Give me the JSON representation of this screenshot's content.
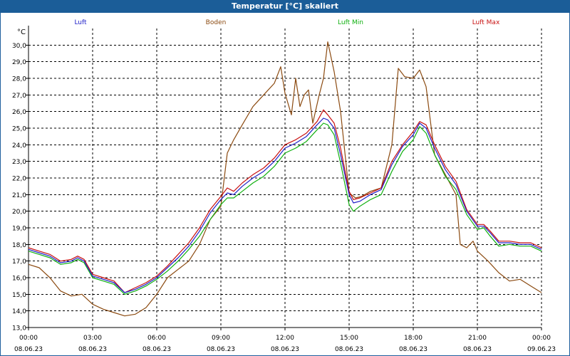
{
  "window": {
    "title": "Temperatur [°C] skaliert"
  },
  "chart_data": {
    "type": "line",
    "title": "Temperatur [°C] skaliert",
    "ylabel": "°C",
    "ylim": [
      13.0,
      31.0
    ],
    "yticks": [
      13.0,
      14.0,
      15.0,
      16.0,
      17.0,
      18.0,
      19.0,
      20.0,
      21.0,
      22.0,
      23.0,
      24.0,
      25.0,
      26.0,
      27.0,
      28.0,
      29.0,
      30.0
    ],
    "ytick_labels": [
      "13,0",
      "14,0",
      "15,0",
      "16,0",
      "17,0",
      "18,0",
      "19,0",
      "20,0",
      "21,0",
      "22,0",
      "23,0",
      "24,0",
      "25,0",
      "26,0",
      "27,0",
      "28,0",
      "29,0",
      "30,0"
    ],
    "xlim_hours": [
      0,
      24
    ],
    "xticks": [
      {
        "hour": 0,
        "time": "00:00",
        "date": "08.06.23"
      },
      {
        "hour": 3,
        "time": "03:00",
        "date": "08.06.23"
      },
      {
        "hour": 6,
        "time": "06:00",
        "date": "08.06.23"
      },
      {
        "hour": 9,
        "time": "09:00",
        "date": "08.06.23"
      },
      {
        "hour": 12,
        "time": "12:00",
        "date": "08.06.23"
      },
      {
        "hour": 15,
        "time": "15:00",
        "date": "08.06.23"
      },
      {
        "hour": 18,
        "time": "18:00",
        "date": "08.06.23"
      },
      {
        "hour": 21,
        "time": "21:00",
        "date": "08.06.23"
      },
      {
        "hour": 24,
        "time": "00:00",
        "date": "09.06.23"
      }
    ],
    "grid": true,
    "legend_position": "top",
    "series": [
      {
        "name": "Luft",
        "color": "#2020c8",
        "points": [
          [
            0,
            17.7
          ],
          [
            0.5,
            17.5
          ],
          [
            1,
            17.3
          ],
          [
            1.5,
            16.9
          ],
          [
            2,
            17.0
          ],
          [
            2.3,
            17.2
          ],
          [
            2.6,
            17.0
          ],
          [
            3,
            16.1
          ],
          [
            3.5,
            15.9
          ],
          [
            4,
            15.7
          ],
          [
            4.5,
            15.1
          ],
          [
            5,
            15.3
          ],
          [
            5.5,
            15.6
          ],
          [
            6,
            16.0
          ],
          [
            6.5,
            16.6
          ],
          [
            7,
            17.2
          ],
          [
            7.5,
            17.9
          ],
          [
            8,
            18.8
          ],
          [
            8.5,
            19.9
          ],
          [
            9,
            20.7
          ],
          [
            9.3,
            21.1
          ],
          [
            9.6,
            21.0
          ],
          [
            10,
            21.5
          ],
          [
            10.5,
            22.0
          ],
          [
            11,
            22.4
          ],
          [
            11.5,
            23.0
          ],
          [
            12,
            23.8
          ],
          [
            12.5,
            24.1
          ],
          [
            13,
            24.5
          ],
          [
            13.5,
            25.2
          ],
          [
            13.8,
            25.6
          ],
          [
            14,
            25.5
          ],
          [
            14.3,
            25.0
          ],
          [
            14.6,
            23.4
          ],
          [
            15,
            21.0
          ],
          [
            15.2,
            20.5
          ],
          [
            15.5,
            20.6
          ],
          [
            16,
            21.0
          ],
          [
            16.5,
            21.3
          ],
          [
            17,
            22.8
          ],
          [
            17.5,
            23.9
          ],
          [
            18,
            24.6
          ],
          [
            18.3,
            25.3
          ],
          [
            18.6,
            25.0
          ],
          [
            19,
            23.8
          ],
          [
            19.5,
            22.5
          ],
          [
            20,
            21.6
          ],
          [
            20.5,
            20.0
          ],
          [
            21,
            19.1
          ],
          [
            21.3,
            19.1
          ],
          [
            21.6,
            18.7
          ],
          [
            22,
            18.1
          ],
          [
            22.5,
            18.1
          ],
          [
            23,
            18.0
          ],
          [
            23.5,
            18.0
          ],
          [
            24,
            17.7
          ]
        ]
      },
      {
        "name": "Boden",
        "color": "#8b4a10",
        "points": [
          [
            0,
            16.8
          ],
          [
            0.5,
            16.6
          ],
          [
            1,
            16.0
          ],
          [
            1.5,
            15.2
          ],
          [
            2,
            14.9
          ],
          [
            2.5,
            15.0
          ],
          [
            3,
            14.4
          ],
          [
            3.5,
            14.1
          ],
          [
            4,
            13.9
          ],
          [
            4.5,
            13.7
          ],
          [
            5,
            13.8
          ],
          [
            5.5,
            14.2
          ],
          [
            6,
            15.0
          ],
          [
            6.5,
            16.0
          ],
          [
            7,
            16.5
          ],
          [
            7.5,
            17.0
          ],
          [
            8,
            18.0
          ],
          [
            8.5,
            19.5
          ],
          [
            9,
            20.3
          ],
          [
            9.3,
            23.5
          ],
          [
            9.6,
            24.3
          ],
          [
            10,
            25.2
          ],
          [
            10.5,
            26.3
          ],
          [
            11,
            27.0
          ],
          [
            11.5,
            27.7
          ],
          [
            11.8,
            28.7
          ],
          [
            12,
            27.1
          ],
          [
            12.3,
            25.8
          ],
          [
            12.5,
            28.0
          ],
          [
            12.7,
            26.3
          ],
          [
            12.9,
            27.0
          ],
          [
            13.1,
            27.3
          ],
          [
            13.3,
            25.3
          ],
          [
            13.6,
            27.0
          ],
          [
            13.8,
            28.0
          ],
          [
            14,
            30.2
          ],
          [
            14.3,
            28.4
          ],
          [
            14.6,
            26.0
          ],
          [
            15,
            21.1
          ],
          [
            15.3,
            20.8
          ],
          [
            15.6,
            20.9
          ],
          [
            16,
            21.2
          ],
          [
            16.5,
            21.4
          ],
          [
            17,
            24.0
          ],
          [
            17.3,
            28.6
          ],
          [
            17.6,
            28.1
          ],
          [
            18,
            28.0
          ],
          [
            18.3,
            28.5
          ],
          [
            18.6,
            27.5
          ],
          [
            19,
            23.4
          ],
          [
            19.5,
            22.2
          ],
          [
            20,
            21.0
          ],
          [
            20.2,
            18.0
          ],
          [
            20.5,
            17.8
          ],
          [
            20.8,
            18.2
          ],
          [
            21,
            17.6
          ],
          [
            21.5,
            17.0
          ],
          [
            22,
            16.3
          ],
          [
            22.5,
            15.8
          ],
          [
            23,
            15.9
          ],
          [
            23.5,
            15.5
          ],
          [
            24,
            15.1
          ]
        ]
      },
      {
        "name": "Luft Min",
        "color": "#10b010",
        "points": [
          [
            0,
            17.6
          ],
          [
            0.5,
            17.4
          ],
          [
            1,
            17.2
          ],
          [
            1.5,
            16.8
          ],
          [
            2,
            16.9
          ],
          [
            2.3,
            17.1
          ],
          [
            2.6,
            16.9
          ],
          [
            3,
            16.0
          ],
          [
            3.5,
            15.8
          ],
          [
            4,
            15.6
          ],
          [
            4.5,
            15.0
          ],
          [
            5,
            15.2
          ],
          [
            5.5,
            15.5
          ],
          [
            6,
            15.9
          ],
          [
            6.5,
            16.4
          ],
          [
            7,
            17.0
          ],
          [
            7.5,
            17.7
          ],
          [
            8,
            18.5
          ],
          [
            8.5,
            19.5
          ],
          [
            9,
            20.4
          ],
          [
            9.3,
            20.8
          ],
          [
            9.6,
            20.8
          ],
          [
            10,
            21.2
          ],
          [
            10.5,
            21.7
          ],
          [
            11,
            22.1
          ],
          [
            11.5,
            22.7
          ],
          [
            12,
            23.5
          ],
          [
            12.5,
            23.8
          ],
          [
            13,
            24.2
          ],
          [
            13.5,
            24.9
          ],
          [
            13.8,
            25.3
          ],
          [
            14,
            25.2
          ],
          [
            14.3,
            24.6
          ],
          [
            14.6,
            22.9
          ],
          [
            15,
            20.4
          ],
          [
            15.2,
            20.0
          ],
          [
            15.5,
            20.3
          ],
          [
            16,
            20.7
          ],
          [
            16.5,
            21.0
          ],
          [
            17,
            22.4
          ],
          [
            17.5,
            23.6
          ],
          [
            18,
            24.3
          ],
          [
            18.3,
            25.1
          ],
          [
            18.6,
            24.7
          ],
          [
            19,
            23.4
          ],
          [
            19.5,
            22.1
          ],
          [
            20,
            21.3
          ],
          [
            20.5,
            19.8
          ],
          [
            21,
            18.9
          ],
          [
            21.3,
            19.0
          ],
          [
            21.6,
            18.5
          ],
          [
            22,
            17.9
          ],
          [
            22.5,
            18.0
          ],
          [
            23,
            17.9
          ],
          [
            23.5,
            17.9
          ],
          [
            24,
            17.6
          ]
        ]
      },
      {
        "name": "Luft Max",
        "color": "#c81010",
        "points": [
          [
            0,
            17.8
          ],
          [
            0.5,
            17.6
          ],
          [
            1,
            17.4
          ],
          [
            1.5,
            17.0
          ],
          [
            2,
            17.1
          ],
          [
            2.3,
            17.3
          ],
          [
            2.6,
            17.1
          ],
          [
            3,
            16.2
          ],
          [
            3.5,
            16.0
          ],
          [
            4,
            15.8
          ],
          [
            4.5,
            15.1
          ],
          [
            5,
            15.4
          ],
          [
            5.5,
            15.7
          ],
          [
            6,
            16.1
          ],
          [
            6.5,
            16.7
          ],
          [
            7,
            17.4
          ],
          [
            7.5,
            18.1
          ],
          [
            8,
            19.0
          ],
          [
            8.5,
            20.1
          ],
          [
            9,
            20.9
          ],
          [
            9.3,
            21.4
          ],
          [
            9.6,
            21.2
          ],
          [
            10,
            21.7
          ],
          [
            10.5,
            22.2
          ],
          [
            11,
            22.6
          ],
          [
            11.5,
            23.2
          ],
          [
            12,
            24.0
          ],
          [
            12.5,
            24.3
          ],
          [
            13,
            24.7
          ],
          [
            13.5,
            25.4
          ],
          [
            13.8,
            26.1
          ],
          [
            14,
            25.8
          ],
          [
            14.3,
            25.3
          ],
          [
            14.6,
            23.8
          ],
          [
            15,
            21.2
          ],
          [
            15.2,
            20.7
          ],
          [
            15.5,
            20.8
          ],
          [
            16,
            21.1
          ],
          [
            16.5,
            21.4
          ],
          [
            17,
            23.0
          ],
          [
            17.5,
            24.0
          ],
          [
            18,
            24.8
          ],
          [
            18.3,
            25.4
          ],
          [
            18.6,
            25.2
          ],
          [
            19,
            24.0
          ],
          [
            19.5,
            22.7
          ],
          [
            20,
            21.8
          ],
          [
            20.5,
            20.1
          ],
          [
            21,
            19.2
          ],
          [
            21.3,
            19.2
          ],
          [
            21.6,
            18.8
          ],
          [
            22,
            18.2
          ],
          [
            22.5,
            18.2
          ],
          [
            23,
            18.1
          ],
          [
            23.5,
            18.1
          ],
          [
            24,
            17.8
          ]
        ]
      }
    ]
  }
}
